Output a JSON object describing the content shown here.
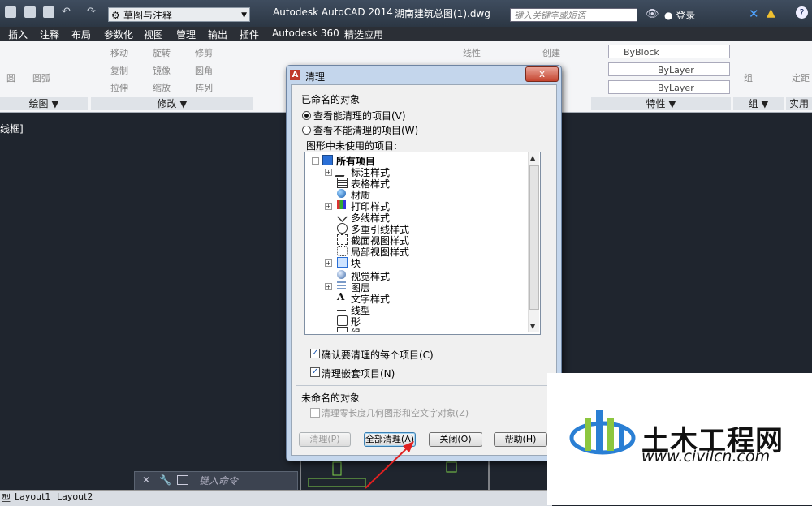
{
  "titlebar": {
    "workspace": "草图与注释",
    "app_title": "Autodesk AutoCAD 2014",
    "doc_title": "湖南建筑总图(1).dwg",
    "search_placeholder": "键入关键字或短语",
    "login": "登录",
    "help": "?"
  },
  "menubar": [
    "插入",
    "注释",
    "布局",
    "参数化",
    "视图",
    "管理",
    "输出",
    "插件",
    "Autodesk 360",
    "精选应用"
  ],
  "ribbon": {
    "draw_items": [
      "圆",
      "圆弧"
    ],
    "modify_items": [
      "移动",
      "旋转",
      "修剪",
      "复制",
      "镜像",
      "圆角",
      "拉伸",
      "缩放",
      "阵列"
    ],
    "annotation_items": [
      "线性"
    ],
    "block_items": [
      "创建"
    ],
    "props": {
      "color": "ByBlock",
      "linetype": "ByLayer",
      "lineweight": "ByLayer"
    },
    "right_items": [
      "组",
      "定距"
    ],
    "panels": {
      "draw": "绘图 ▼",
      "modify": "修改 ▼",
      "properties": "特性 ▼",
      "group": "组 ▼",
      "util": "实用"
    }
  },
  "canvas_label": "线框]",
  "dialog": {
    "title": "清理",
    "close": "x",
    "named_objects": "已命名的对象",
    "radio_purgeable": "查看能清理的项目(V)",
    "radio_not_purgeable": "查看不能清理的项目(W)",
    "unused_items": "图形中未使用的项目:",
    "tree": [
      "所有项目",
      "标注样式",
      "表格样式",
      "材质",
      "打印样式",
      "多线样式",
      "多重引线样式",
      "截面视图样式",
      "局部视图样式",
      "块",
      "视觉样式",
      "图层",
      "文字样式",
      "线型",
      "形",
      "组"
    ],
    "confirm_each": "确认要清理的每个项目(C)",
    "purge_nested": "清理嵌套项目(N)",
    "unnamed_objects": "未命名的对象",
    "zero_length": "清理零长度几何图形和空文字对象(Z)",
    "buttons": {
      "purge": "清理(P)",
      "purge_all": "全部清理(A)",
      "close": "关闭(O)",
      "help": "帮助(H)"
    }
  },
  "command": {
    "placeholder": "键入命令"
  },
  "layout_tabs": [
    "型",
    "Layout1",
    "Layout2"
  ],
  "watermark": {
    "title": "土木工程网",
    "url": "www.civilcn.com"
  },
  "colors": {
    "dialog_frame": "#c4d6ec",
    "close_red": "#c5442f",
    "canvas": "#1f252e",
    "arrow": "#e02020"
  }
}
